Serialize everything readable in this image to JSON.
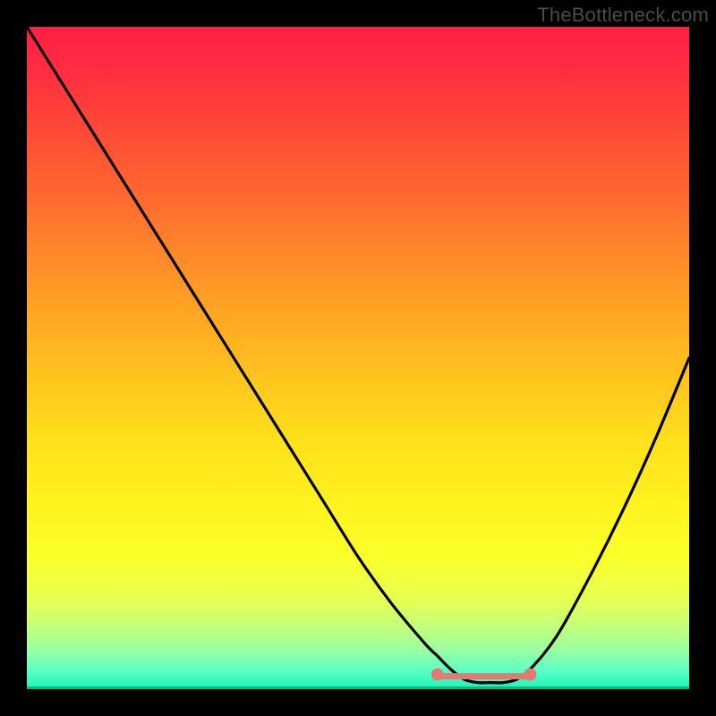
{
  "watermark": "TheBottleneck.com",
  "colors": {
    "frame_bg": "#000000",
    "curve_stroke": "#000000",
    "marker_fill": "#e47a74",
    "gradient_top": "#ff1f44",
    "gradient_bottom": "#17f7b6"
  },
  "chart_data": {
    "type": "line",
    "title": "",
    "xlabel": "",
    "ylabel": "",
    "xlim": [
      0,
      100
    ],
    "ylim": [
      0,
      100
    ],
    "grid": false,
    "legend": false,
    "x": [
      0,
      5,
      10,
      15,
      20,
      25,
      30,
      35,
      40,
      45,
      50,
      55,
      60,
      62,
      64,
      66,
      68,
      70,
      72,
      74,
      76,
      80,
      85,
      90,
      95,
      100
    ],
    "values": [
      100,
      92,
      84,
      76,
      68,
      60,
      52,
      44,
      36,
      28,
      20,
      13,
      7,
      5,
      3,
      1.5,
      1,
      1,
      1,
      1.5,
      3,
      8,
      17,
      27,
      38,
      50
    ],
    "trough_range_x": [
      62,
      76
    ],
    "trough_y": 1,
    "markers_x": [
      62,
      76
    ],
    "annotations": []
  }
}
